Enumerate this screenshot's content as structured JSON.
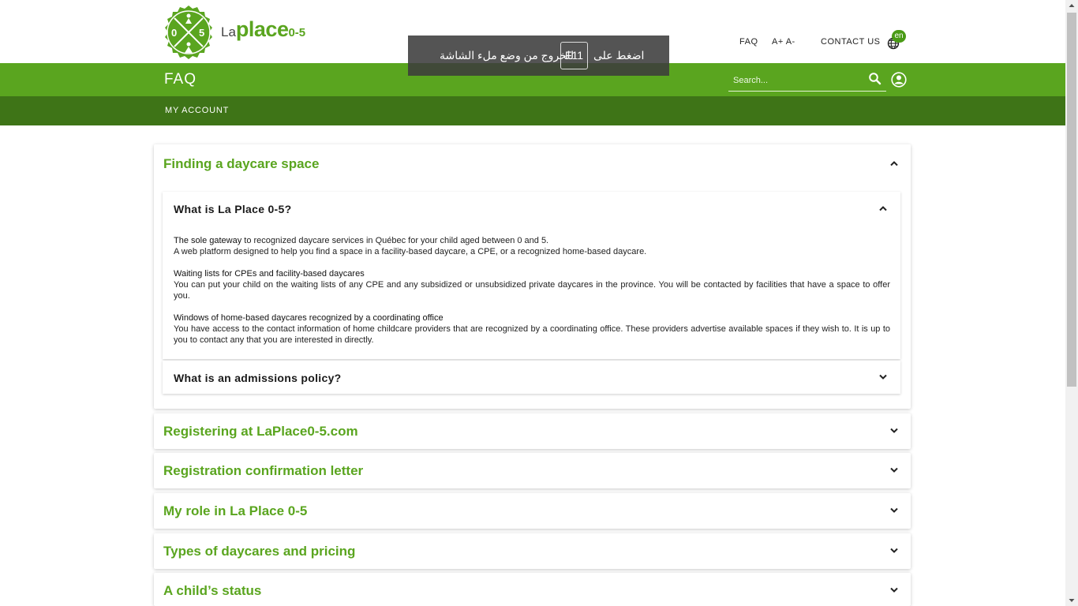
{
  "header": {
    "logo_left_digit": "0",
    "logo_right_digit": "5",
    "brand_la": "La",
    "brand_place": "place",
    "brand_range": "0-5",
    "links": {
      "faq": "FAQ",
      "font_size": "A+ A-",
      "contact": "CONTACT US"
    },
    "lang_badge": "en"
  },
  "fullscreen_notice": {
    "press": "اضغط على",
    "key": "F11",
    "exit": "للخروج من وضع ملء الشاشة"
  },
  "nav": {
    "page_title": "FAQ",
    "search": {
      "placeholder": "Search..."
    },
    "sub_items": [
      "MY ACCOUNT"
    ]
  },
  "faq": {
    "sections": [
      {
        "title": "Finding a daycare space",
        "questions": [
          {
            "title": "What is La Place 0-5?",
            "answer": {
              "p1_bold": "The sole gateway",
              "p1_rest": " to recognized daycare services in Québec for your child aged between 0 and 5.",
              "p1_line2": "A web platform designed to help you find a space in a facility-based daycare, a CPE, or a recognized home-based daycare.",
              "p2_heading": "Waiting lists for CPEs and facility-based daycares",
              "p2_text": "You can put your child on the waiting lists of any CPE and any subsidized or unsubsidized private daycares in the province. You will be contacted by facilities that have a space to offer you.",
              "p3_heading": "Windows of home-based daycares recognized by a coordinating office",
              "p3_text": "You have access to the contact information of home childcare providers that are recognized by a coordinating office. These providers advertise available spaces if they wish to. It is up to you to contact any that you are interested in directly."
            }
          },
          {
            "title": "What is an admissions policy?"
          }
        ]
      },
      {
        "title": "Registering at LaPlace0-5.com"
      },
      {
        "title": "Registration confirmation letter"
      },
      {
        "title": "My role in La Place 0-5"
      },
      {
        "title": "Types of daycares and pricing"
      },
      {
        "title": "A child’s status"
      }
    ]
  },
  "colors": {
    "brand_green": "#5aa51f",
    "dark_green": "#3e7417",
    "header_text": "#222222"
  },
  "icons": [
    "logo-icon",
    "globe-icon",
    "search-icon",
    "user-icon",
    "chevron-up-icon",
    "chevron-down-icon"
  ]
}
